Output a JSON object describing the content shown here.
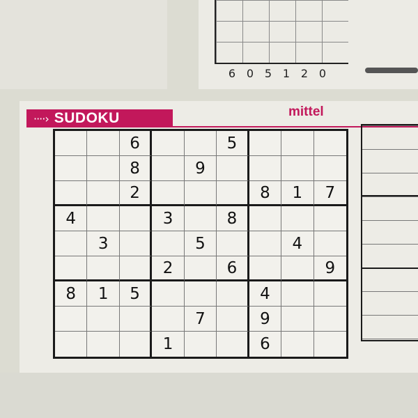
{
  "top_strip": {
    "digits": [
      "6",
      "0",
      "5",
      "1",
      "2",
      "0"
    ]
  },
  "header": {
    "arrow": "····›",
    "title": "SUDOKU",
    "difficulty": "mittel",
    "accent_color": "#c2185b"
  },
  "sudoku": {
    "rows": [
      [
        "",
        "",
        "6",
        "",
        "",
        "5",
        "",
        "",
        ""
      ],
      [
        "",
        "",
        "8",
        "",
        "9",
        "",
        "",
        "",
        ""
      ],
      [
        "",
        "",
        "2",
        "",
        "",
        "",
        "8",
        "1",
        "7"
      ],
      [
        "4",
        "",
        "",
        "3",
        "",
        "8",
        "",
        "",
        ""
      ],
      [
        "",
        "3",
        "",
        "",
        "5",
        "",
        "",
        "4",
        ""
      ],
      [
        "",
        "",
        "",
        "2",
        "",
        "6",
        "",
        "",
        "9"
      ],
      [
        "8",
        "1",
        "5",
        "",
        "",
        "",
        "4",
        "",
        ""
      ],
      [
        "",
        "",
        "",
        "",
        "7",
        "",
        "9",
        "",
        ""
      ],
      [
        "",
        "",
        "",
        "1",
        "",
        "",
        "6",
        "",
        ""
      ]
    ]
  }
}
